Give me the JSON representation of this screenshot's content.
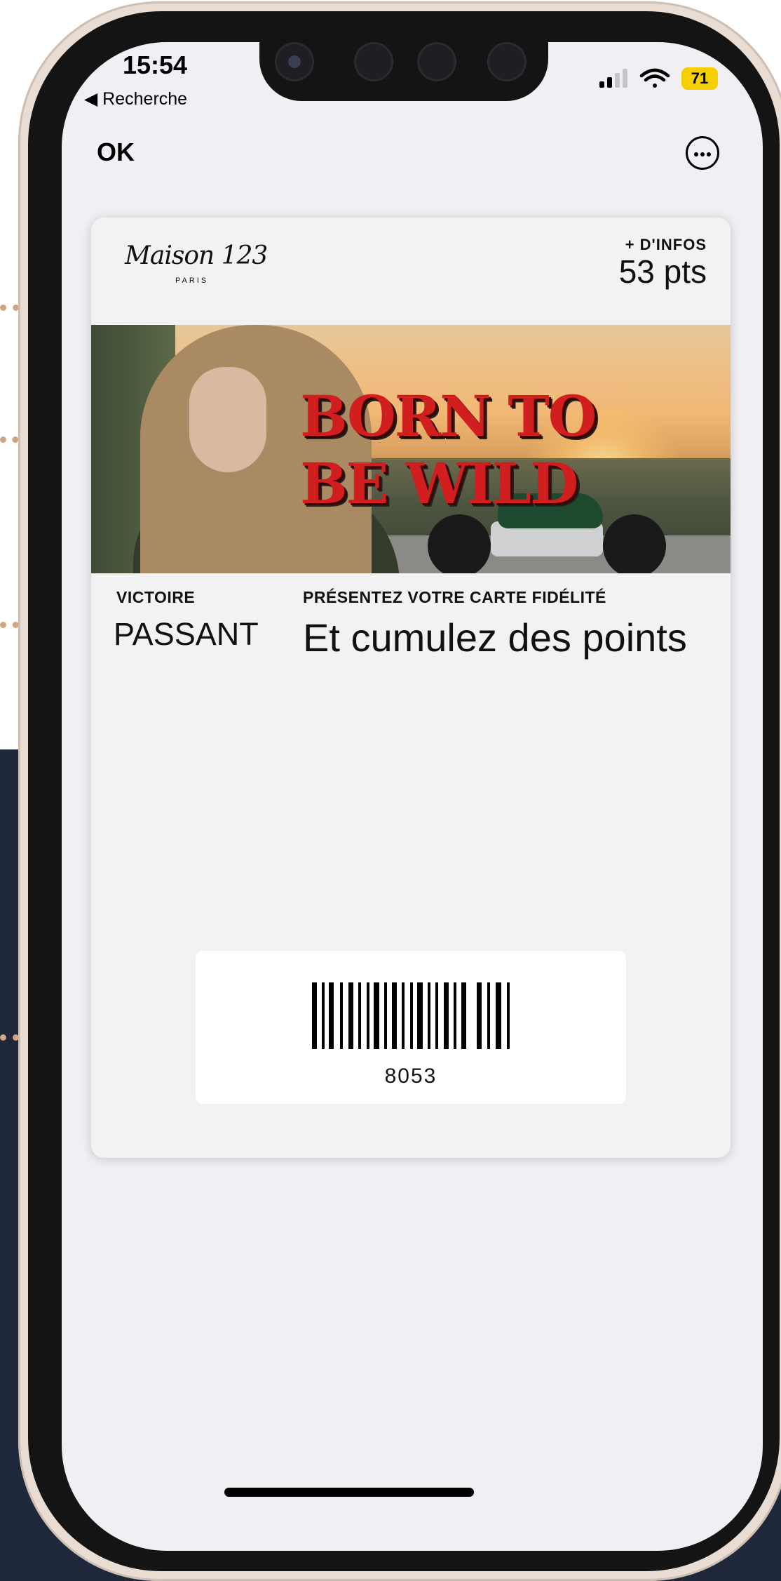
{
  "status_bar": {
    "time": "15:54",
    "back_app": "◀ Recherche",
    "battery": "71"
  },
  "nav": {
    "ok_label": "OK",
    "more_icon": "ellipsis-circle-icon"
  },
  "card": {
    "brand_logo": "Maison 123",
    "brand_subtitle": "PARIS",
    "header_label": "+ D'INFOS",
    "points": "53 pts",
    "banner_title_line1": "BORN TO",
    "banner_title_line2": "BE WILD",
    "fields": {
      "name_label": "VICTOIRE",
      "name_value": "PASSANT",
      "promo_label": "PRÉSENTEZ VOTRE CARTE FIDÉLITÉ",
      "promo_value": "Et cumulez des points"
    },
    "barcode_value": "8053"
  },
  "colors": {
    "leader_dots": "#d0a583",
    "banner_text": "#d11e1e",
    "battery": "#f5d000",
    "background_dark": "#1e283a"
  }
}
